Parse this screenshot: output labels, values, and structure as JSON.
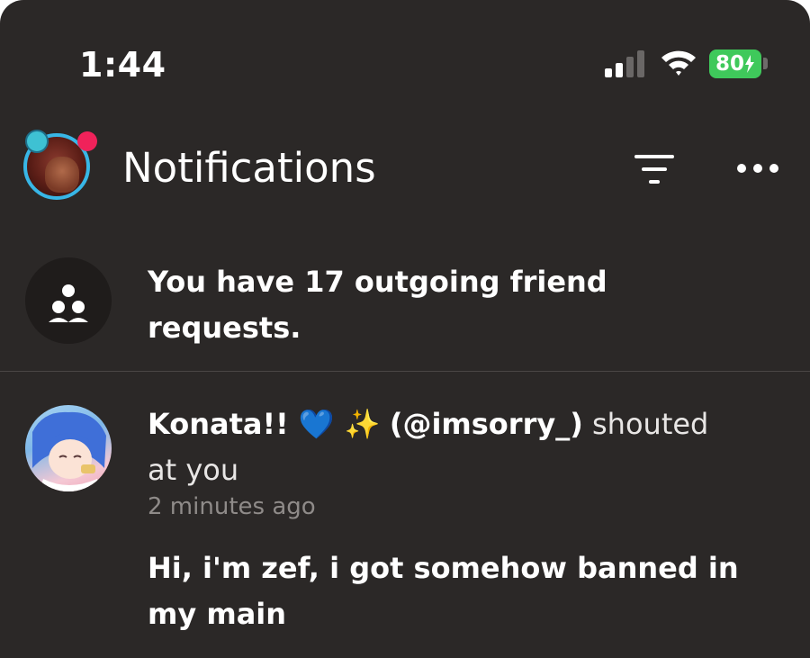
{
  "status_bar": {
    "time": "1:44",
    "battery_level": "80",
    "battery_color": "#3fc95b",
    "icons": [
      "signal-icon",
      "wifi-icon",
      "battery-charging-icon"
    ]
  },
  "header": {
    "title": "Notifications",
    "icons": [
      "filter-icon",
      "more-icon"
    ],
    "notification_dot_color": "#f0225a"
  },
  "friend_requests": {
    "icon": "friends-group-icon",
    "text": "You have 17 outgoing friend requests."
  },
  "shout": {
    "display_name": "Konata!! 💙 ✨",
    "handle": "(@imsorry_)",
    "action": "shouted at you",
    "time": "2 minutes ago",
    "message": "Hi, i'm zef, i got somehow banned in my main"
  }
}
